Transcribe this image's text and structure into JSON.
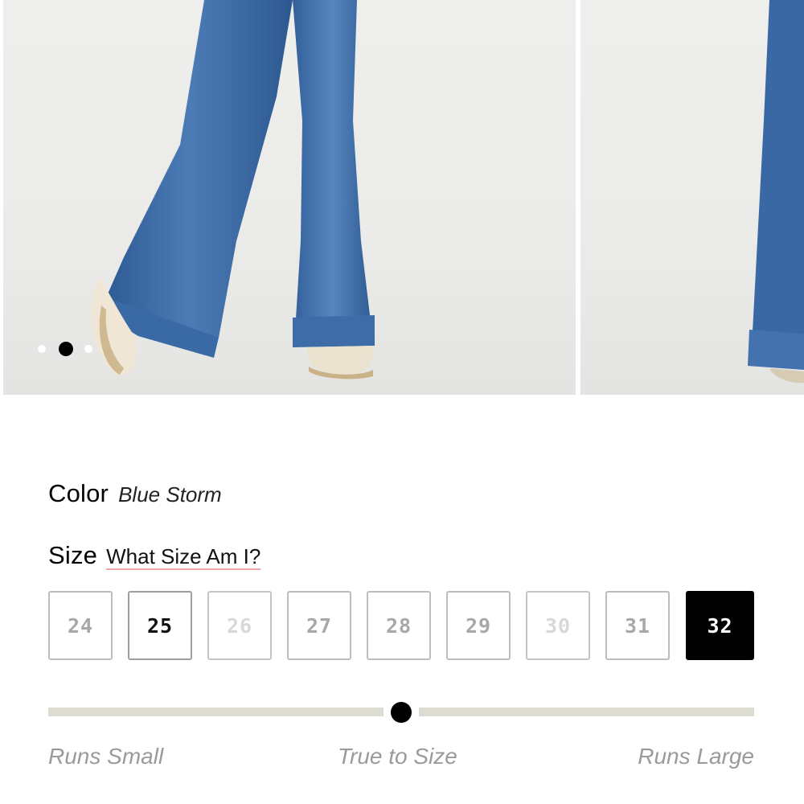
{
  "gallery": {
    "images": [
      {
        "alt": "Flare jeans front view",
        "icon": "product-photo"
      },
      {
        "alt": "Flare jeans side view",
        "icon": "product-photo"
      }
    ],
    "dots": {
      "count": 3,
      "active_index": 1
    }
  },
  "color": {
    "label": "Color",
    "value": "Blue Storm"
  },
  "size": {
    "label": "Size",
    "guide_link": "What Size Am I?",
    "options": [
      {
        "label": "24",
        "state": "muted"
      },
      {
        "label": "25",
        "state": "available"
      },
      {
        "label": "26",
        "state": "unavailable"
      },
      {
        "label": "27",
        "state": "muted"
      },
      {
        "label": "28",
        "state": "muted"
      },
      {
        "label": "29",
        "state": "muted"
      },
      {
        "label": "30",
        "state": "unavailable"
      },
      {
        "label": "31",
        "state": "muted"
      },
      {
        "label": "32",
        "state": "selected"
      }
    ]
  },
  "fit": {
    "labels": {
      "small": "Runs Small",
      "true": "True to Size",
      "large": "Runs Large"
    },
    "position_fraction": 0.5
  },
  "colors": {
    "denim": "#3d6aa3",
    "selected_bg": "#000000",
    "underline_accent": "#f0a6a6",
    "track": "#dcdcd2"
  }
}
